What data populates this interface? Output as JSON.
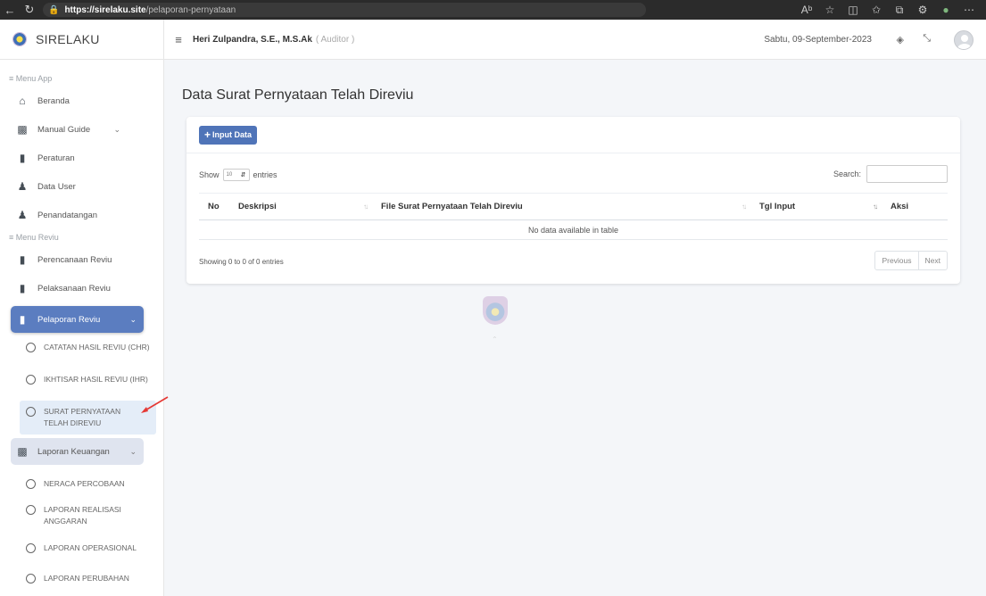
{
  "browser": {
    "url_host": "https://sirelaku.site",
    "url_path": "/pelaporan-pernyataan",
    "icons": [
      "back-icon",
      "refresh-icon",
      "lock-icon",
      "read-aloud-icon",
      "favorite-icon",
      "split-screen-icon",
      "favorites-icon",
      "collections-icon",
      "extensions-icon",
      "profile-icon",
      "more-icon"
    ]
  },
  "app": {
    "brand": "SIRELAKU"
  },
  "sidebar": {
    "section_app": "≡ Menu App",
    "section_reviu": "≡ Menu Reviu",
    "items": [
      {
        "label": "Beranda",
        "icon": "home-icon"
      },
      {
        "label": "Manual Guide",
        "icon": "book-icon"
      },
      {
        "label": "Peraturan",
        "icon": "bookmark-icon"
      },
      {
        "label": "Data User",
        "icon": "users-icon"
      },
      {
        "label": "Penandatangan",
        "icon": "user-icon"
      }
    ],
    "reviu_items": [
      {
        "label": "Perencanaan Reviu",
        "icon": "file-icon"
      },
      {
        "label": "Pelaksanaan Reviu",
        "icon": "file-icon"
      },
      {
        "label": "Pelaporan Reviu",
        "icon": "file-icon"
      }
    ],
    "pelaporan_sub": [
      {
        "label": "CATATAN HASIL REVIU (CHR)"
      },
      {
        "label": "IKHTISAR HASIL REVIU (IHR)"
      },
      {
        "label": "SURAT PERNYATAAN TELAH DIREVIU"
      }
    ],
    "laporan_keuangan": {
      "label": "Laporan Keuangan",
      "icon": "building-icon"
    },
    "keuangan_sub": [
      {
        "label": "NERACA PERCOBAAN"
      },
      {
        "label": "LAPORAN REALISASI ANGGARAN"
      },
      {
        "label": "LAPORAN OPERASIONAL"
      },
      {
        "label": "LAPORAN PERUBAHAN"
      }
    ]
  },
  "topbar": {
    "user_name": "Heri Zulpandra, S.E., M.S.Ak",
    "user_role": "( Auditor )",
    "date": "Sabtu, 09-September-2023"
  },
  "main": {
    "title": "Data Surat Pernyataan Telah Direviu",
    "input_button": "Input Data",
    "show_label": "Show",
    "entries_value": "10",
    "entries_label": "entries",
    "search_label": "Search:",
    "search_value": "",
    "columns": [
      "No",
      "Deskripsi",
      "File Surat Pernyataan Telah Direviu",
      "Tgl Input",
      "Aksi"
    ],
    "empty_text": "No data available in table",
    "info": "Showing 0 to 0 of 0 entries",
    "prev_label": "Previous",
    "next_label": "Next"
  },
  "colors": {
    "accent": "#5b7dc0",
    "button": "#4f74b8",
    "annotation_arrow": "#e53935"
  }
}
